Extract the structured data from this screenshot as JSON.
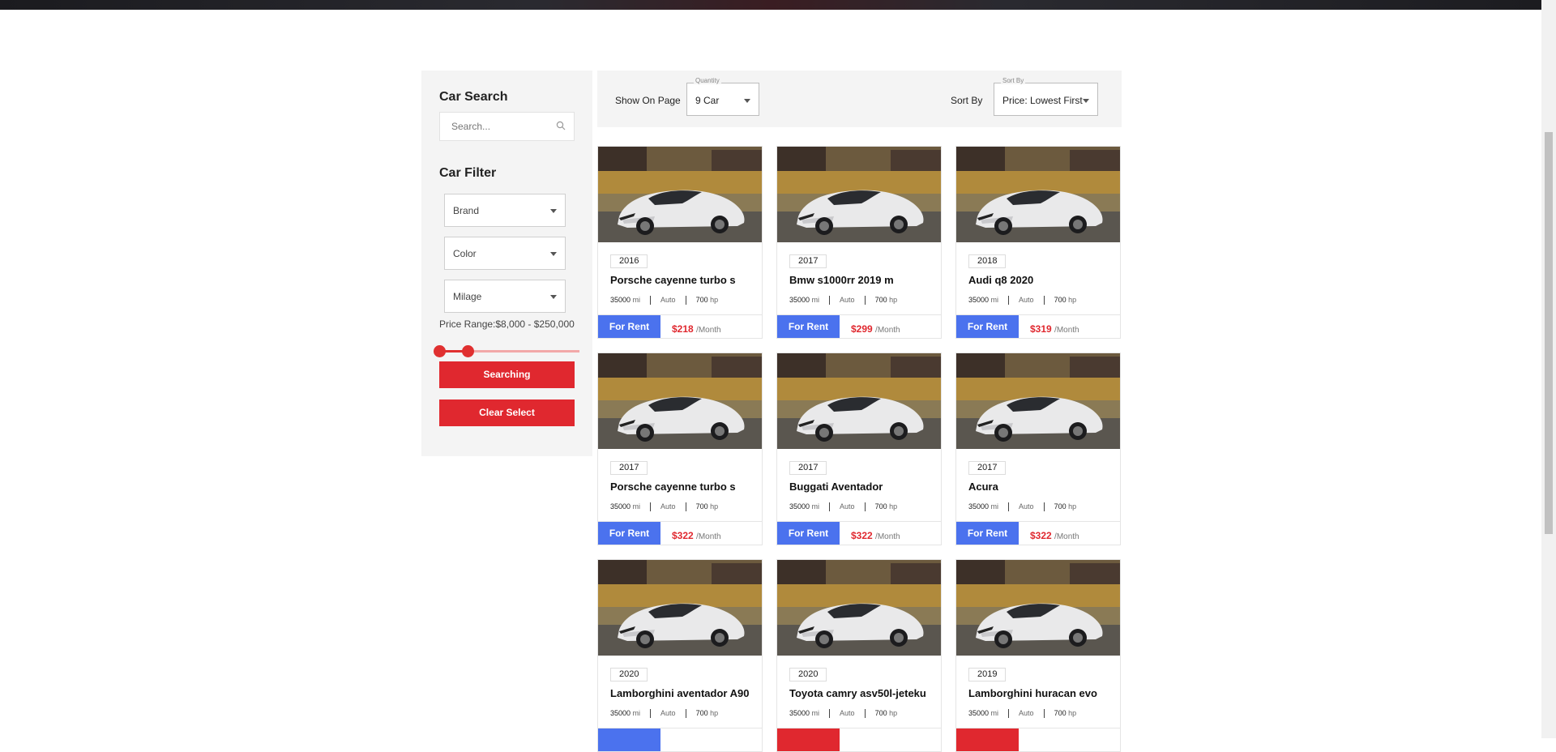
{
  "sidebar": {
    "search_title": "Car Search",
    "search_placeholder": "Search...",
    "filter_title": "Car Filter",
    "filters": [
      {
        "label": "Brand"
      },
      {
        "label": "Color"
      },
      {
        "label": "Milage"
      }
    ],
    "price_range_label": "Price Range:",
    "price_range_value": "$8,000 - $250,000",
    "searching_label": "Searching",
    "clear_label": "Clear Select"
  },
  "toolbar": {
    "show_on_page_label": "Show On Page",
    "quantity_legend": "Quantity",
    "quantity_value": "9 Car",
    "sort_by_label": "Sort By",
    "sort_legend": "Sort By",
    "sort_value": "Price: Lowest First"
  },
  "colors": {
    "rent_blue": "#4b72ee",
    "accent_red": "#e0282f"
  },
  "cars": [
    {
      "year": "2016",
      "name": "Porsche cayenne turbo s",
      "miles": "35000",
      "miles_unit": "mi",
      "trans": "Auto",
      "hp": "700",
      "hp_unit": "hp",
      "action": "For Rent",
      "price": "$218",
      "period": "/Month",
      "action_color": "blue"
    },
    {
      "year": "2017",
      "name": "Bmw s1000rr 2019 m",
      "miles": "35000",
      "miles_unit": "mi",
      "trans": "Auto",
      "hp": "700",
      "hp_unit": "hp",
      "action": "For Rent",
      "price": "$299",
      "period": "/Month",
      "action_color": "blue"
    },
    {
      "year": "2018",
      "name": "Audi q8 2020",
      "miles": "35000",
      "miles_unit": "mi",
      "trans": "Auto",
      "hp": "700",
      "hp_unit": "hp",
      "action": "For Rent",
      "price": "$319",
      "period": "/Month",
      "action_color": "blue"
    },
    {
      "year": "2017",
      "name": "Porsche cayenne turbo s",
      "miles": "35000",
      "miles_unit": "mi",
      "trans": "Auto",
      "hp": "700",
      "hp_unit": "hp",
      "action": "For Rent",
      "price": "$322",
      "period": "/Month",
      "action_color": "blue"
    },
    {
      "year": "2017",
      "name": "Buggati Aventador",
      "miles": "35000",
      "miles_unit": "mi",
      "trans": "Auto",
      "hp": "700",
      "hp_unit": "hp",
      "action": "For Rent",
      "price": "$322",
      "period": "/Month",
      "action_color": "blue"
    },
    {
      "year": "2017",
      "name": "Acura",
      "miles": "35000",
      "miles_unit": "mi",
      "trans": "Auto",
      "hp": "700",
      "hp_unit": "hp",
      "action": "For Rent",
      "price": "$322",
      "period": "/Month",
      "action_color": "blue"
    },
    {
      "year": "2020",
      "name": "Lamborghini aventador A90",
      "miles": "35000",
      "miles_unit": "mi",
      "trans": "Auto",
      "hp": "700",
      "hp_unit": "hp",
      "action": "",
      "price": "",
      "period": "",
      "action_color": "blue"
    },
    {
      "year": "2020",
      "name": "Toyota camry asv50l-jeteku",
      "miles": "35000",
      "miles_unit": "mi",
      "trans": "Auto",
      "hp": "700",
      "hp_unit": "hp",
      "action": "",
      "price": "",
      "period": "",
      "action_color": "red"
    },
    {
      "year": "2019",
      "name": "Lamborghini huracan evo",
      "miles": "35000",
      "miles_unit": "mi",
      "trans": "Auto",
      "hp": "700",
      "hp_unit": "hp",
      "action": "",
      "price": "",
      "period": "",
      "action_color": "red"
    }
  ]
}
